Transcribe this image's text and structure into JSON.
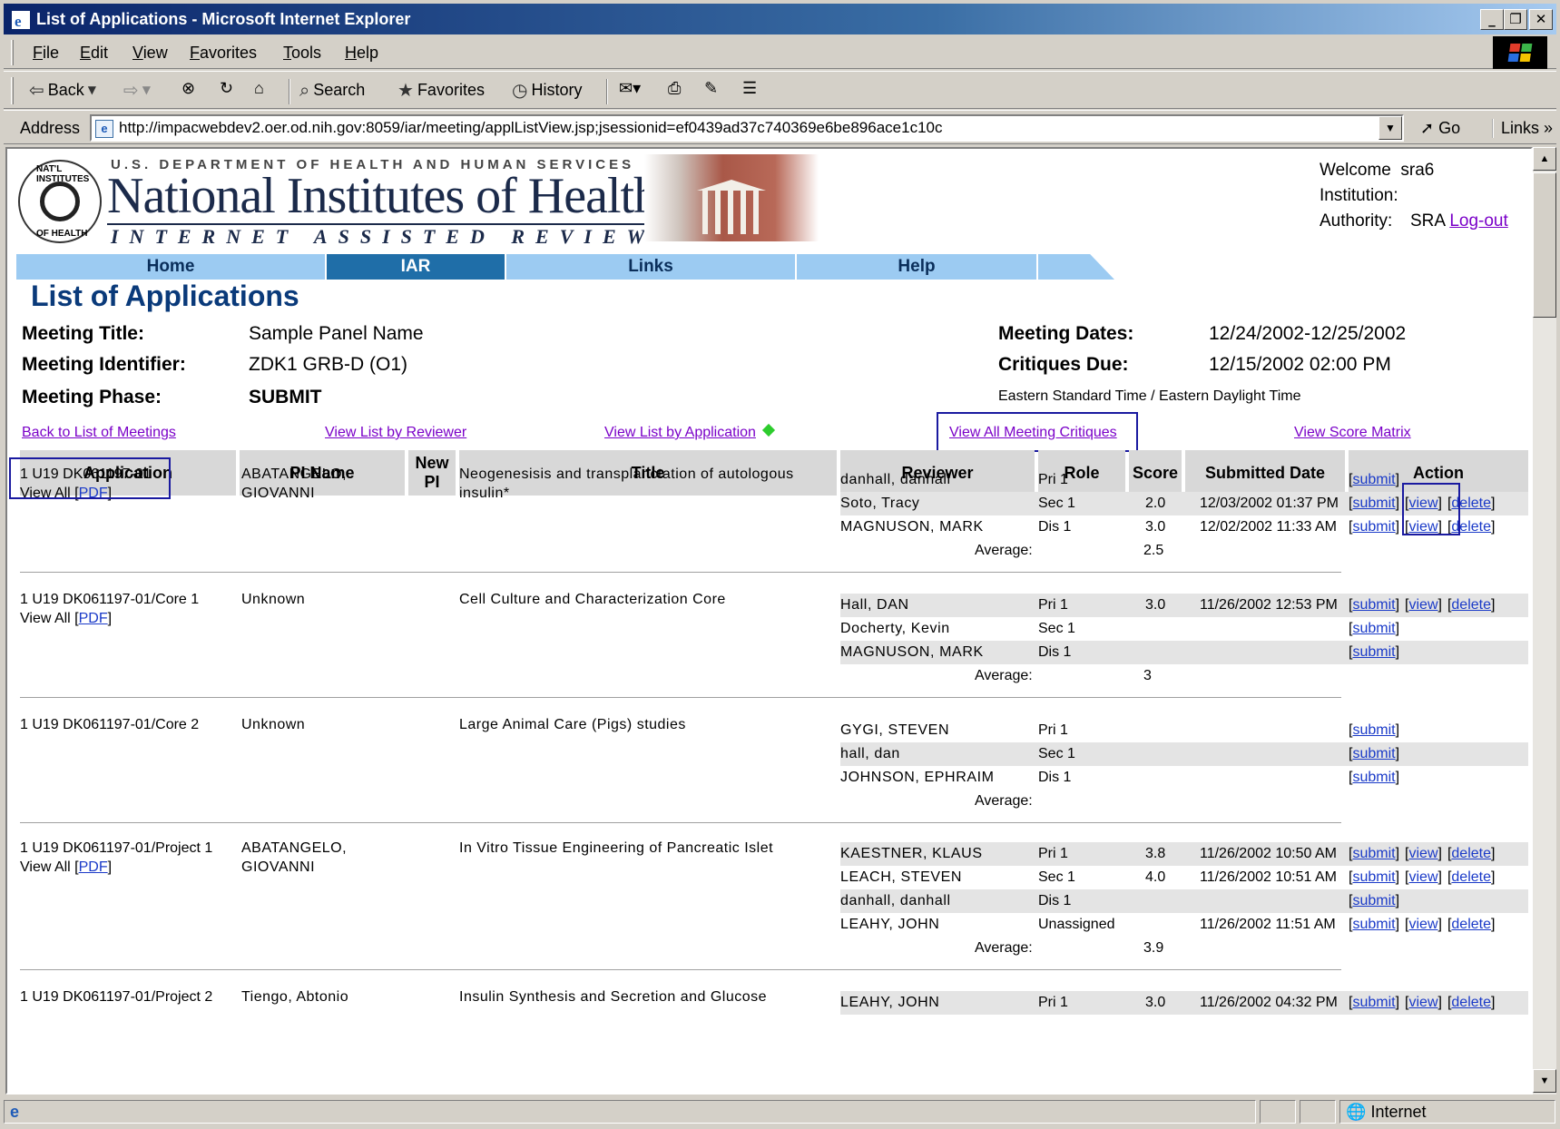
{
  "window": {
    "title": "List of Applications - Microsoft Internet Explorer",
    "min": "_",
    "max": "❐",
    "close": "✕"
  },
  "menu": [
    "File",
    "Edit",
    "View",
    "Favorites",
    "Tools",
    "Help"
  ],
  "toolbar": {
    "back": "Back",
    "search": "Search",
    "favorites": "Favorites",
    "history": "History"
  },
  "address": {
    "label": "Address",
    "url": "http://impacwebdev2.oer.od.nih.gov:8059/iar/meeting/applListView.jsp;jsessionid=ef0439ad37c740369e6be896ace1c10c",
    "go": "Go",
    "links": "Links"
  },
  "header": {
    "dept": "U.S. DEPARTMENT OF HEALTH AND HUMAN SERVICES",
    "org": "National Institutes of Health",
    "system": "INTERNET ASSISTED REVIEW",
    "welcome_label": "Welcome",
    "welcome_user": "sra6",
    "institution_label": "Institution:",
    "institution_value": "",
    "authority_label": "Authority:",
    "authority_value": "SRA",
    "logout": "Log-out"
  },
  "nav": {
    "tabs": [
      "Home",
      "IAR",
      "Links",
      "Help"
    ],
    "active": "IAR"
  },
  "page_title": "List of Applications",
  "meeting": {
    "title_label": "Meeting Title:",
    "title": "Sample Panel Name",
    "id_label": "Meeting Identifier:",
    "id": "ZDK1 GRB-D (O1)",
    "phase_label": "Meeting Phase:",
    "phase": "SUBMIT",
    "dates_label": "Meeting Dates:",
    "dates": "12/24/2002-12/25/2002",
    "due_label": "Critiques Due:",
    "due": "12/15/2002 02:00 PM",
    "timezone": "Eastern Standard Time / Eastern Daylight Time"
  },
  "links": {
    "back": "Back to List of Meetings",
    "by_reviewer": "View List by Reviewer",
    "by_application": "View List by Application",
    "all_critiques": "View All Meeting Critiques",
    "score_matrix": "View Score Matrix"
  },
  "columns": {
    "application": "Application",
    "pi_name": "PI Name",
    "new_pi": "New PI",
    "title": "Title",
    "reviewer": "Reviewer",
    "role": "Role",
    "score": "Score",
    "submitted": "Submitted Date",
    "action": "Action"
  },
  "labels": {
    "view_all": "View All",
    "pdf": "PDF",
    "average": "Average:",
    "submit": "submit",
    "view": "view",
    "delete": "delete"
  },
  "applications": [
    {
      "id": "1 U19 DK061197-01",
      "view_all": true,
      "pi": [
        "ABATANGELO,",
        "GIOVANNI"
      ],
      "title": "Neogenesisis and transplanctation of autologous insulin*",
      "average": "2.5",
      "reviewers": [
        {
          "name": "danhall, danhall",
          "role": "Pri 1",
          "score": "",
          "date": "",
          "view": false
        },
        {
          "name": "Soto, Tracy",
          "role": "Sec 1",
          "score": "2.0",
          "date": "12/03/2002 01:37 PM",
          "view": true
        },
        {
          "name": "MAGNUSON, MARK",
          "role": "Dis 1",
          "score": "3.0",
          "date": "12/02/2002 11:33 AM",
          "view": true
        }
      ]
    },
    {
      "id": "1 U19 DK061197-01/Core 1",
      "view_all": true,
      "pi": [
        "Unknown"
      ],
      "title": "Cell Culture and Characterization Core",
      "average": "3",
      "reviewers": [
        {
          "name": "Hall, DAN",
          "role": "Pri 1",
          "score": "3.0",
          "date": "11/26/2002 12:53 PM",
          "view": true
        },
        {
          "name": "Docherty, Kevin",
          "role": "Sec 1",
          "score": "",
          "date": "",
          "view": false
        },
        {
          "name": "MAGNUSON, MARK",
          "role": "Dis 1",
          "score": "",
          "date": "",
          "view": false
        }
      ]
    },
    {
      "id": "1 U19 DK061197-01/Core 2",
      "view_all": false,
      "pi": [
        "Unknown"
      ],
      "title": "Large Animal Care (Pigs) studies",
      "average": "",
      "reviewers": [
        {
          "name": "GYGI, STEVEN",
          "role": "Pri 1",
          "score": "",
          "date": "",
          "view": false
        },
        {
          "name": "hall, dan",
          "role": "Sec 1",
          "score": "",
          "date": "",
          "view": false
        },
        {
          "name": "JOHNSON, EPHRAIM",
          "role": "Dis 1",
          "score": "",
          "date": "",
          "view": false
        }
      ]
    },
    {
      "id": "1 U19 DK061197-01/Project 1",
      "view_all": true,
      "pi": [
        "ABATANGELO,",
        "GIOVANNI"
      ],
      "title": "In Vitro Tissue Engineering of Pancreatic Islet",
      "average": "3.9",
      "reviewers": [
        {
          "name": "KAESTNER, KLAUS",
          "role": "Pri 1",
          "score": "3.8",
          "date": "11/26/2002 10:50 AM",
          "view": true
        },
        {
          "name": "LEACH, STEVEN",
          "role": "Sec 1",
          "score": "4.0",
          "date": "11/26/2002 10:51 AM",
          "view": true
        },
        {
          "name": "danhall, danhall",
          "role": "Dis 1",
          "score": "",
          "date": "",
          "view": false
        },
        {
          "name": "LEAHY, JOHN",
          "role": "Unassigned",
          "score": "",
          "date": "11/26/2002 11:51 AM",
          "view": true
        }
      ]
    },
    {
      "id": "1 U19 DK061197-01/Project 2",
      "view_all": false,
      "pi": [
        "Tiengo, Abtonio"
      ],
      "title": "Insulin Synthesis and Secretion and Glucose",
      "average": null,
      "reviewers": [
        {
          "name": "LEAHY, JOHN",
          "role": "Pri 1",
          "score": "3.0",
          "date": "11/26/2002 04:32 PM",
          "view": true
        }
      ]
    }
  ],
  "status": {
    "zone": "Internet"
  }
}
